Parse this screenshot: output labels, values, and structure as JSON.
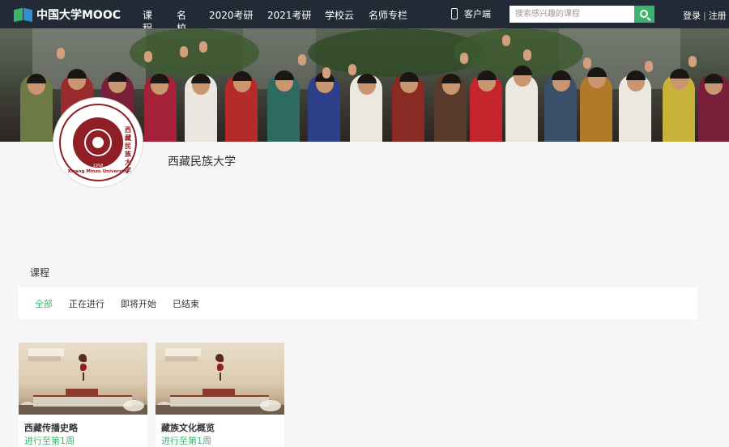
{
  "nav": {
    "logo_text": "中国大学MOOC",
    "items": [
      "课程",
      "名校",
      "2020考研",
      "2021考研",
      "学校云",
      "名师专栏"
    ],
    "client_label": "客户端",
    "search_placeholder": "搜索感兴趣的课程",
    "login": "登录",
    "separator": "|",
    "register": "注册"
  },
  "university": {
    "name": "西藏民族大学",
    "logo_cn": "西藏民族大学",
    "logo_en": "Xizang Minzu University",
    "logo_year": "1958"
  },
  "courses": {
    "section_title": "课程",
    "tabs": [
      "全部",
      "正在进行",
      "即将开始",
      "已结束"
    ],
    "active_tab": "全部",
    "items": [
      {
        "title": "西藏传播史略",
        "status": "进行至第1周"
      },
      {
        "title": "藏族文化概览",
        "status": "进行至第1周"
      }
    ]
  },
  "colors": {
    "nav_bg": "#222a35",
    "accent_green": "#3cb46e",
    "brand_red": "#8f1e25"
  }
}
